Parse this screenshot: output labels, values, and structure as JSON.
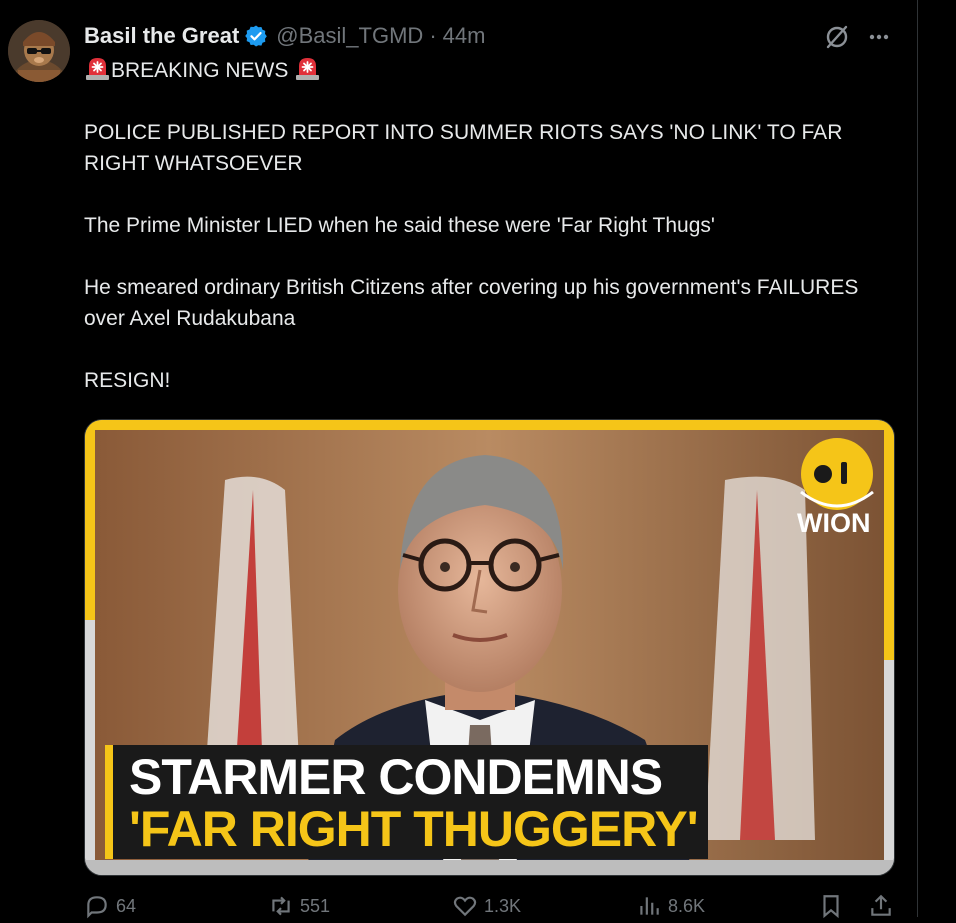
{
  "tweet": {
    "author": {
      "display_name": "Basil the Great",
      "handle": "@Basil_TGMD",
      "verified": true,
      "verified_color": "#1d9bf0"
    },
    "separator": "·",
    "time": "44m",
    "icons": {
      "grok": "grok-icon",
      "more": "more-icon",
      "siren": "police-siren-emoji"
    },
    "lines": {
      "breaking": "BREAKING NEWS",
      "headline": "POLICE PUBLISHED REPORT INTO SUMMER RIOTS SAYS 'NO LINK' TO FAR RIGHT WHATSOEVER",
      "pm": "The Prime Minister LIED when he said these were 'Far Right Thugs'",
      "smear": "He smeared ordinary British Citizens after covering up his government's FAILURES over Axel Rudakubana",
      "resign": "RESIGN!"
    },
    "media": {
      "overlay_line1": "STARMER CONDEMNS",
      "overlay_line2": "'FAR RIGHT THUGGERY'",
      "brand": "WION",
      "accent_color": "#f5c518"
    },
    "actions": {
      "replies": "64",
      "reposts": "551",
      "likes": "1.3K",
      "views": "8.6K"
    }
  }
}
